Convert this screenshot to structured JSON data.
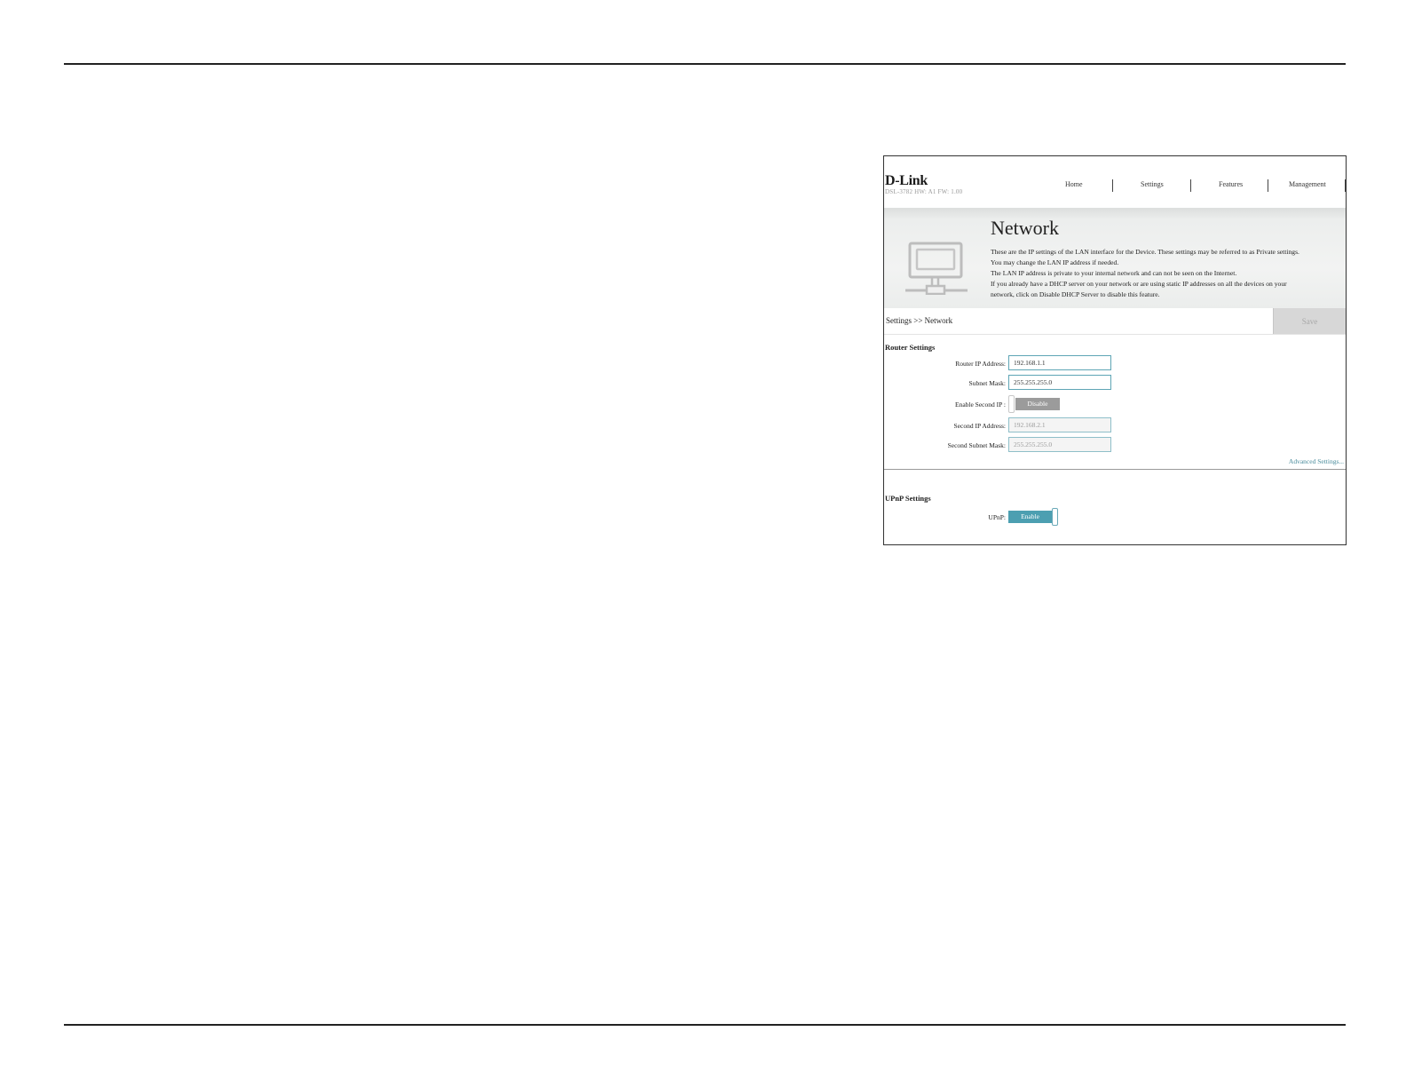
{
  "header": {
    "brand": "D-Link",
    "device_info": "DSL-3782 HW: A1 FW: 1.00",
    "nav": [
      "Home",
      "Settings",
      "Features",
      "Management"
    ]
  },
  "banner": {
    "title": "Network",
    "description": [
      "These are the IP settings of the LAN interface for the Device. These settings may be referred to as Private settings.",
      "You may change the LAN IP address if needed.",
      "The LAN IP address is private to your internal network and can not be seen on the Internet.",
      "If you already have a DHCP server on your network or are using static IP addresses on all the devices on your",
      "network, click on Disable DHCP Server to disable this feature."
    ]
  },
  "breadcrumb": "Settings >> Network",
  "toolbar": {
    "save_label": "Save"
  },
  "router_settings": {
    "title": "Router Settings",
    "router_ip_label": "Router IP Address:",
    "router_ip_value": "192.168.1.1",
    "subnet_mask_label": "Subnet Mask:",
    "subnet_mask_value": "255.255.255.0",
    "enable_second_ip_label": "Enable Second IP :",
    "enable_second_ip_state": "Disable",
    "second_ip_label": "Second IP Address:",
    "second_ip_value": "192.168.2.1",
    "second_subnet_label": "Second Subnet Mask:",
    "second_subnet_value": "255.255.255.0",
    "advanced_link": "Advanced Settings..."
  },
  "upnp_settings": {
    "title": "UPnP Settings",
    "upnp_label": "UPnP:",
    "upnp_state": "Enable"
  },
  "colors": {
    "accent": "#4c9fb1",
    "field_border": "#5ea5b5",
    "toggle_off": "#9b9b9b",
    "save_disabled": "#d7d7d7"
  }
}
